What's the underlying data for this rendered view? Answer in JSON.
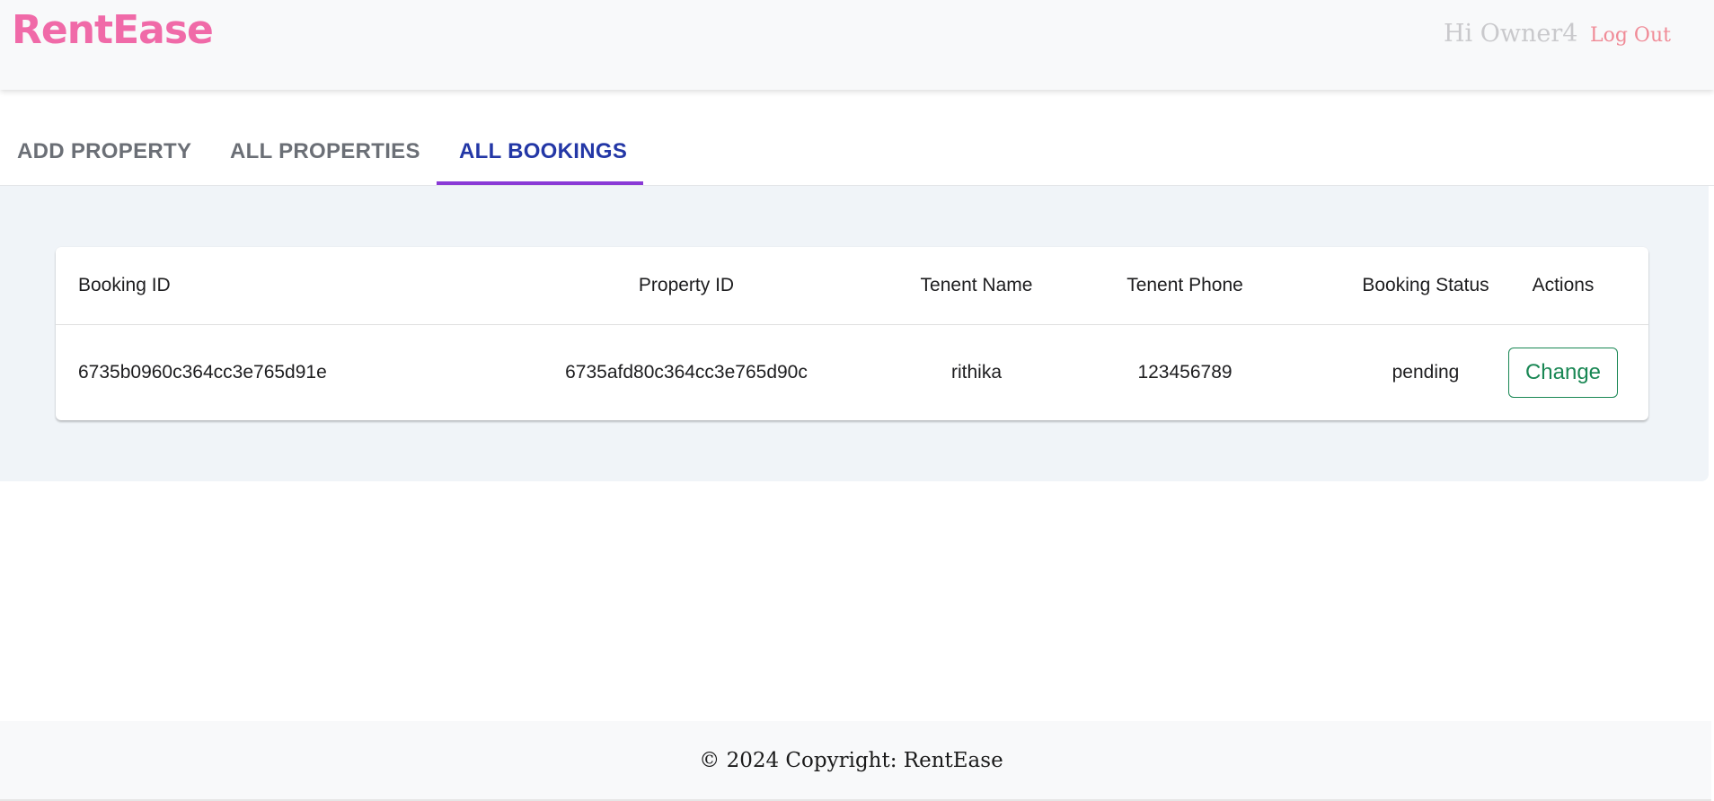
{
  "header": {
    "brand": "RentEase",
    "greeting": "Hi Owner4",
    "logout_label": "Log Out"
  },
  "tabs": [
    {
      "label": "ADD PROPERTY",
      "active": false
    },
    {
      "label": "ALL PROPERTIES",
      "active": false
    },
    {
      "label": "ALL BOOKINGS",
      "active": true
    }
  ],
  "table": {
    "columns": [
      "Booking ID",
      "Property ID",
      "Tenent Name",
      "Tenent Phone",
      "Booking Status",
      "Actions"
    ],
    "rows": [
      {
        "booking_id": "6735b0960c364cc3e765d91e",
        "property_id": "6735afd80c364cc3e765d90c",
        "tenant_name": "rithika",
        "tenant_phone": "123456789",
        "status": "pending",
        "action_label": "Change"
      }
    ]
  },
  "footer": {
    "copyright": "© 2024 Copyright: RentEase"
  },
  "colors": {
    "brand": "#f06aa8",
    "logout": "#f08b97",
    "active_tab": "#2337a6",
    "tab_indicator": "#8a3ad6",
    "action_button": "#198754",
    "content_bg": "#f0f4f8"
  }
}
